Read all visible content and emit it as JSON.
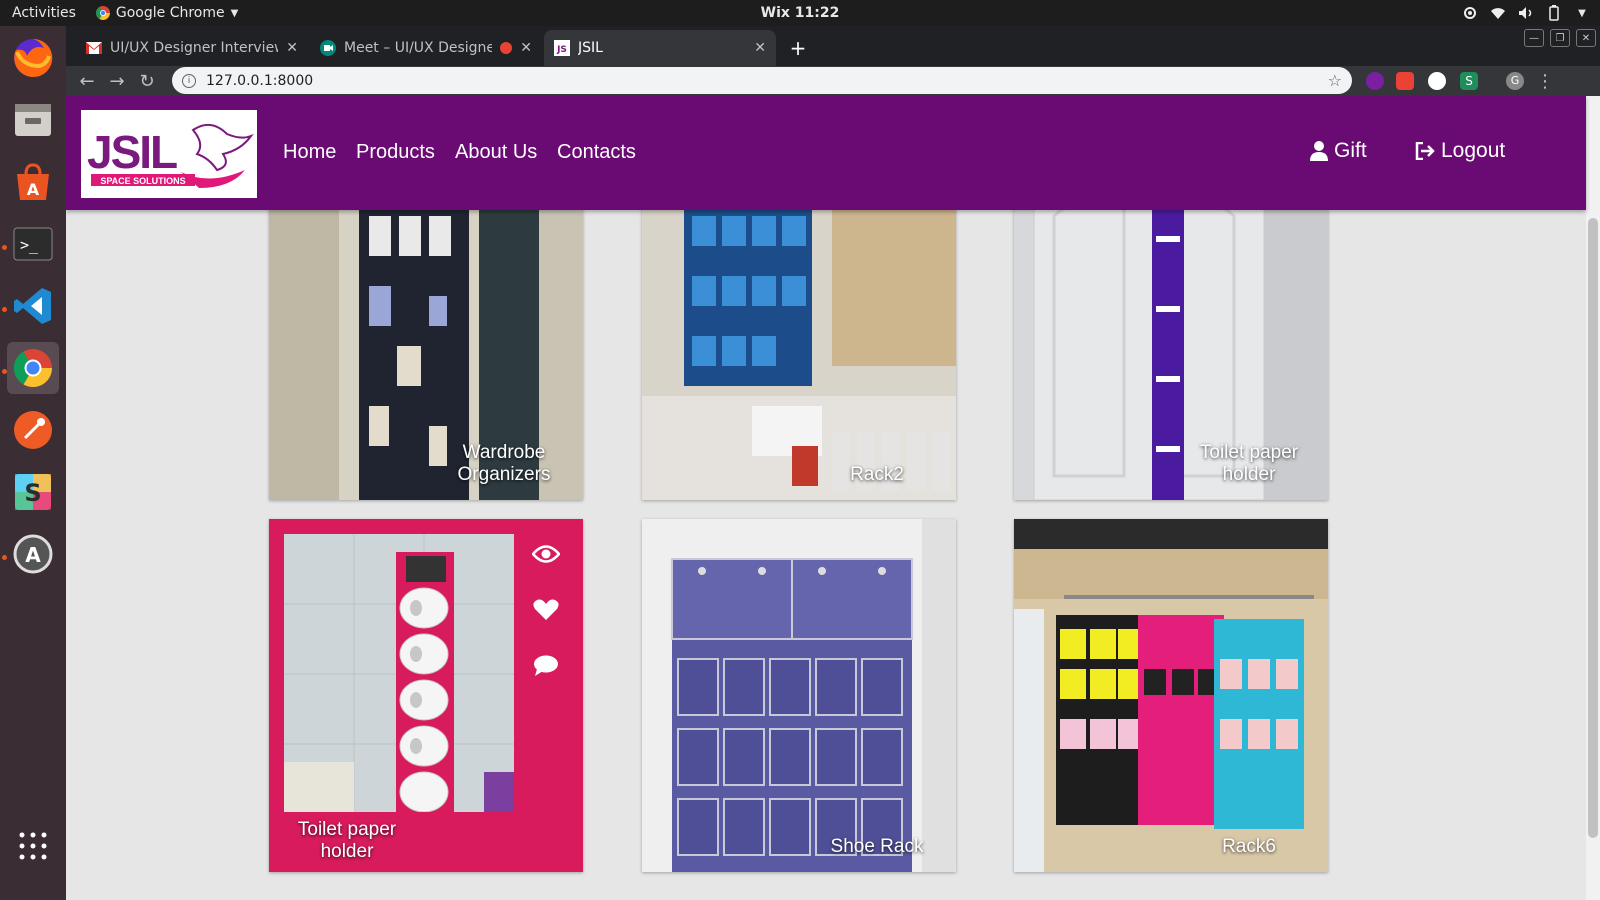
{
  "topbar": {
    "activities": "Activities",
    "app_name": "Google Chrome",
    "clock": "Wix 11:22"
  },
  "dock": {
    "items": [
      "firefox-icon",
      "files-icon",
      "software-center-icon",
      "terminal-icon",
      "vscode-icon",
      "chrome-icon",
      "postman-icon",
      "slack-icon",
      "software-updater-icon",
      "app-grid-icon"
    ]
  },
  "browser": {
    "tabs": [
      {
        "title": "UI/UX Designer Interview",
        "icon": "gmail-icon"
      },
      {
        "title": "Meet – UI/UX Designer",
        "icon": "meet-icon"
      },
      {
        "title": "JSIL",
        "icon": "jsil-favicon"
      }
    ],
    "url": "127.0.0.1:8000"
  },
  "site": {
    "logo_text": "JSIL",
    "logo_tagline": "SPACE SOLUTIONS",
    "nav": [
      "Home",
      "Products",
      "About Us",
      "Contacts"
    ],
    "gift_label": "Gift",
    "logout_label": "Logout"
  },
  "products": [
    {
      "caption": "Wardrobe Organizers"
    },
    {
      "caption": "Rack2"
    },
    {
      "caption": "Toilet paper holder"
    },
    {
      "caption": "Toilet paper holder"
    },
    {
      "caption": "Shoe Rack"
    },
    {
      "caption": "Rack6"
    }
  ],
  "colors": {
    "nav_bg": "#6a0a73",
    "hover_card": "#d81b5c",
    "logo_purple": "#7a1a7e",
    "logo_pink": "#e0187a"
  }
}
